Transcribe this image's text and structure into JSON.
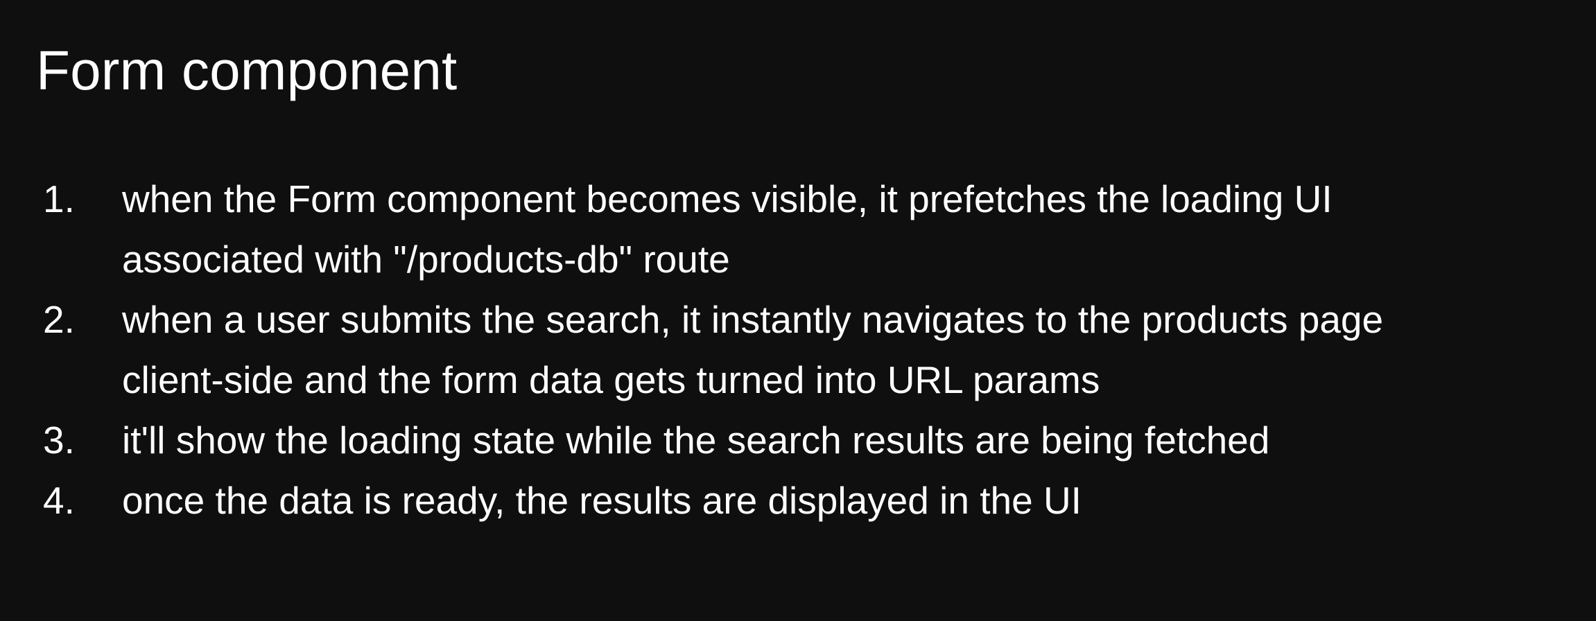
{
  "slide": {
    "title": "Form component",
    "background_color": "#0f0f0f",
    "text_color": "#ffffff",
    "steps": [
      {
        "number": "1.",
        "lines": [
          "when the Form component becomes visible, it prefetches the loading UI",
          "associated with \"/products-db\" route"
        ]
      },
      {
        "number": "2.",
        "lines": [
          "when a user submits the search, it instantly navigates to the products page",
          "client-side and the form data gets turned into URL params"
        ]
      },
      {
        "number": "3.",
        "lines": [
          "it'll show the loading state while the search results are being fetched"
        ]
      },
      {
        "number": "4.",
        "lines": [
          "once the data is ready, the results are displayed in the UI"
        ]
      }
    ]
  }
}
